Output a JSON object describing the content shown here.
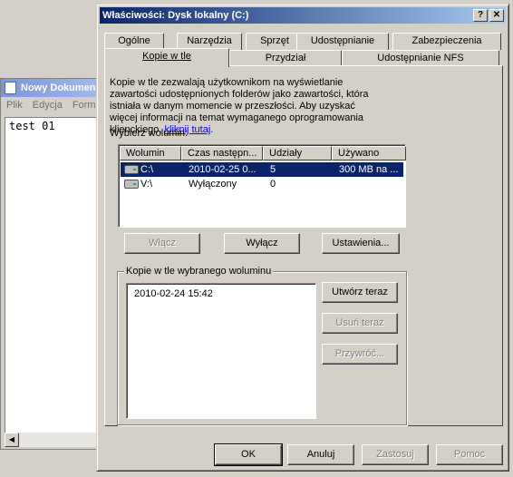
{
  "background_window": {
    "title": "Nowy Dokument",
    "menu": [
      "Plik",
      "Edycja",
      "Form"
    ],
    "content": "test 01"
  },
  "dialog": {
    "title": "Właściwości: Dysk lokalny (C:)",
    "help_button": "?",
    "close_button": "✕",
    "tabs_row1": [
      "Ogólne",
      "Narzędzia",
      "Sprzęt",
      "Udostępnianie",
      "Zabezpieczenia"
    ],
    "tabs_row2": [
      "Kopie w tle",
      "Przydział",
      "Udostępnianie NFS"
    ],
    "active_tab": "Kopie w tle",
    "description": "Kopie w tle zezwalają użytkownikom na wyświetlanie zawartości udostępnionych folderów jako zawartości, która istniała w danym momencie w przeszłości. Aby uzyskać więcej informacji na temat wymaganego oprogramowania klienckiego, ",
    "description_link": "kliknij tutaj",
    "description_end": ".",
    "select_volume_label": "Wybierz wolumin:",
    "volume_table": {
      "columns": [
        "Wolumin",
        "Czas następn...",
        "Udziały",
        "Używano"
      ],
      "rows": [
        {
          "volume": "C:\\",
          "next_time": "2010-02-25 0...",
          "shares": "5",
          "used": "300 MB na ...",
          "selected": true
        },
        {
          "volume": "V:\\",
          "next_time": "Wyłączony",
          "shares": "0",
          "used": "",
          "selected": false
        }
      ]
    },
    "buttons": {
      "enable": "Włącz",
      "disable": "Wyłącz",
      "settings": "Ustawienia..."
    },
    "shadow_group_label": "Kopie w tle wybranego woluminu",
    "shadow_copies": [
      "2010-02-24 15:42"
    ],
    "shadow_buttons": {
      "create_now": "Utwórz teraz",
      "delete_now": "Usuń teraz",
      "restore": "Przywróć..."
    },
    "footer": {
      "ok": "OK",
      "cancel": "Anuluj",
      "apply": "Zastosuj",
      "help": "Pomoc"
    }
  }
}
